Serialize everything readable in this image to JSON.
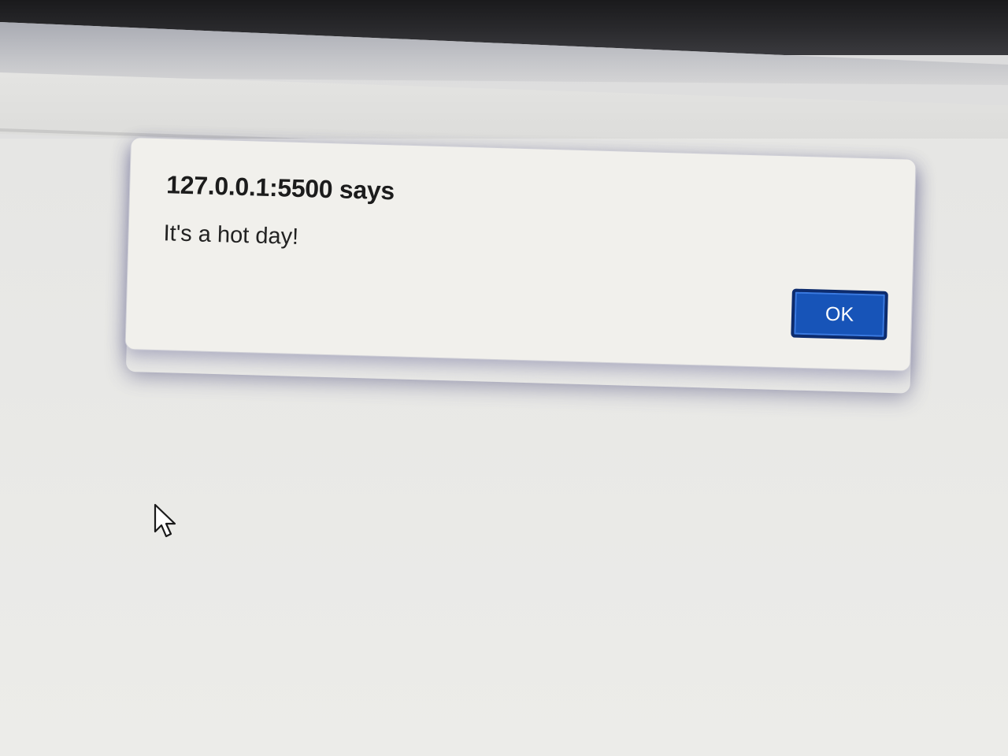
{
  "dialog": {
    "title": "127.0.0.1:5500 says",
    "message": "It's a hot day!",
    "ok_label": "OK"
  },
  "colors": {
    "ok_button": "#1754b8",
    "ok_border": "#0d2c6e",
    "dialog_bg": "#f1f0ec"
  },
  "icons": {
    "cursor": "mouse-pointer-icon"
  }
}
